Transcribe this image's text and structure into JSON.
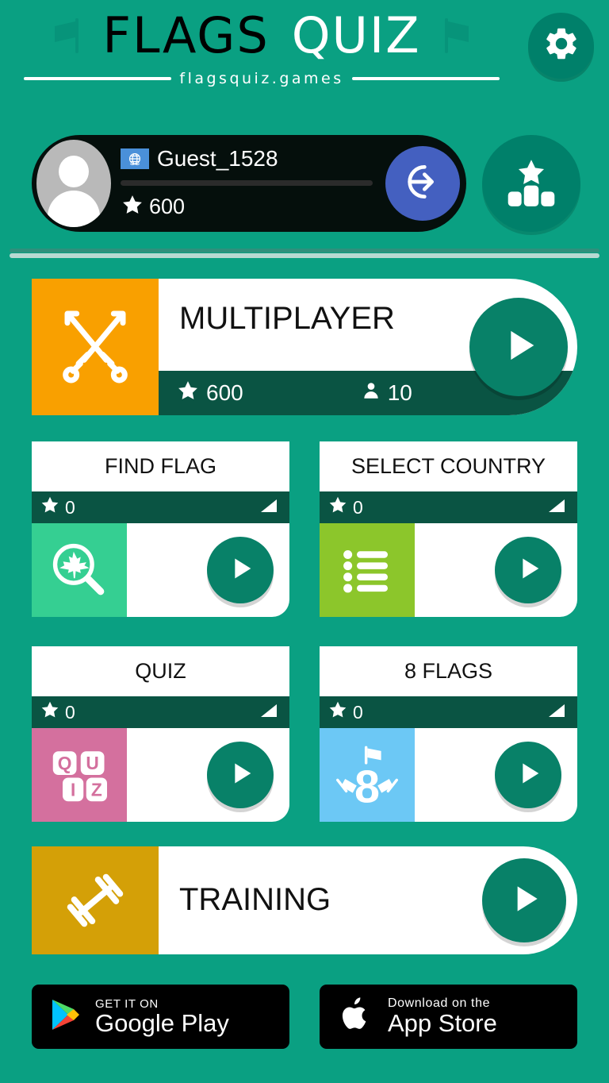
{
  "header": {
    "logo_part1": "FLAGS",
    "logo_part2": "QUIZ",
    "subtitle": "flagsquiz.games",
    "settings_icon": "gear-icon",
    "flag_icon": "flag-icon",
    "accent_green": "#0aa082",
    "dark_green": "#0a5443",
    "button_green": "#00806a"
  },
  "profile": {
    "country_flag": "un-flag",
    "username": "Guest_1528",
    "score": "600",
    "score_icon": "star-icon",
    "login_icon": "login-icon",
    "login_color": "#4460c0",
    "leaderboard_icon": "leaderboard-podium-icon"
  },
  "modes": {
    "multiplayer": {
      "title": "MULTIPLAYER",
      "score": "600",
      "players": "10",
      "icon": "crossed-swords-icon",
      "icon_bg": "#f9a000",
      "play_label": "play-icon"
    },
    "training": {
      "title": "TRAINING",
      "icon": "dumbbell-icon",
      "icon_bg": "#d4a007",
      "play_label": "play-icon"
    },
    "cards": [
      {
        "title": "FIND FLAG",
        "score": "0",
        "icon": "magnifier-leaf-icon",
        "icon_bg": "#35cf92",
        "difficulty_icon": "signal-triangle-icon"
      },
      {
        "title": "SELECT COUNTRY",
        "score": "0",
        "icon": "list-icon",
        "icon_bg": "#8cc62b",
        "difficulty_icon": "signal-triangle-icon"
      },
      {
        "title": "QUIZ",
        "score": "0",
        "icon": "quiz-letters-icon",
        "icon_bg": "#d4709e",
        "difficulty_icon": "signal-triangle-icon"
      },
      {
        "title": "8 FLAGS",
        "score": "0",
        "icon": "eight-flags-icon",
        "icon_bg": "#6cc8f5",
        "difficulty_icon": "signal-triangle-icon"
      }
    ]
  },
  "store": {
    "google_play": {
      "small": "GET IT ON",
      "big": "Google Play",
      "icon": "google-play-icon"
    },
    "app_store": {
      "small": "Download on the",
      "big": "App Store",
      "icon": "apple-icon"
    }
  }
}
